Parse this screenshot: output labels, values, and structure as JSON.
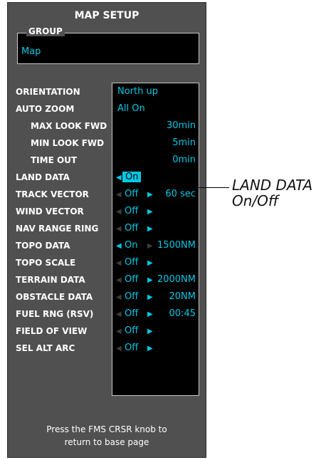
{
  "panel": {
    "title": "MAP SETUP",
    "group": {
      "label": "GROUP",
      "value": "Map"
    },
    "rows": [
      {
        "label": "ORIENTATION",
        "value": "North up",
        "second": ""
      },
      {
        "label": "AUTO ZOOM",
        "value": "All On",
        "second": ""
      },
      {
        "label": "MAX LOOK FWD",
        "value": "",
        "second": "30min"
      },
      {
        "label": "MIN LOOK FWD",
        "value": "",
        "second": "5min"
      },
      {
        "label": "TIME OUT",
        "value": "",
        "second": "0min"
      },
      {
        "label": "LAND DATA",
        "value": "On",
        "second": ""
      },
      {
        "label": "TRACK VECTOR",
        "value": "Off",
        "second": "60 sec"
      },
      {
        "label": "WIND VECTOR",
        "value": "Off",
        "second": ""
      },
      {
        "label": "NAV RANGE RING",
        "value": "Off",
        "second": ""
      },
      {
        "label": "TOPO DATA",
        "value": "On",
        "second": "1500NM"
      },
      {
        "label": "TOPO SCALE",
        "value": "Off",
        "second": ""
      },
      {
        "label": "TERRAIN DATA",
        "value": "Off",
        "second": "2000NM"
      },
      {
        "label": "OBSTACLE DATA",
        "value": "Off",
        "second": "20NM"
      },
      {
        "label": "FUEL RNG (RSV)",
        "value": "Off",
        "second": "00:45"
      },
      {
        "label": "FIELD OF VIEW",
        "value": "Off",
        "second": ""
      },
      {
        "label": "SEL ALT ARC",
        "value": "Off",
        "second": ""
      }
    ],
    "footer_line1": "Press the FMS CRSR knob to",
    "footer_line2": "return to base page"
  },
  "callout": {
    "line1": "LAND DATA",
    "line2": "On/Off"
  },
  "colors": {
    "panel_bg": "#505050",
    "value_cyan": "#00c8e6",
    "value_bg": "#000000",
    "label_white": "#ffffff"
  }
}
